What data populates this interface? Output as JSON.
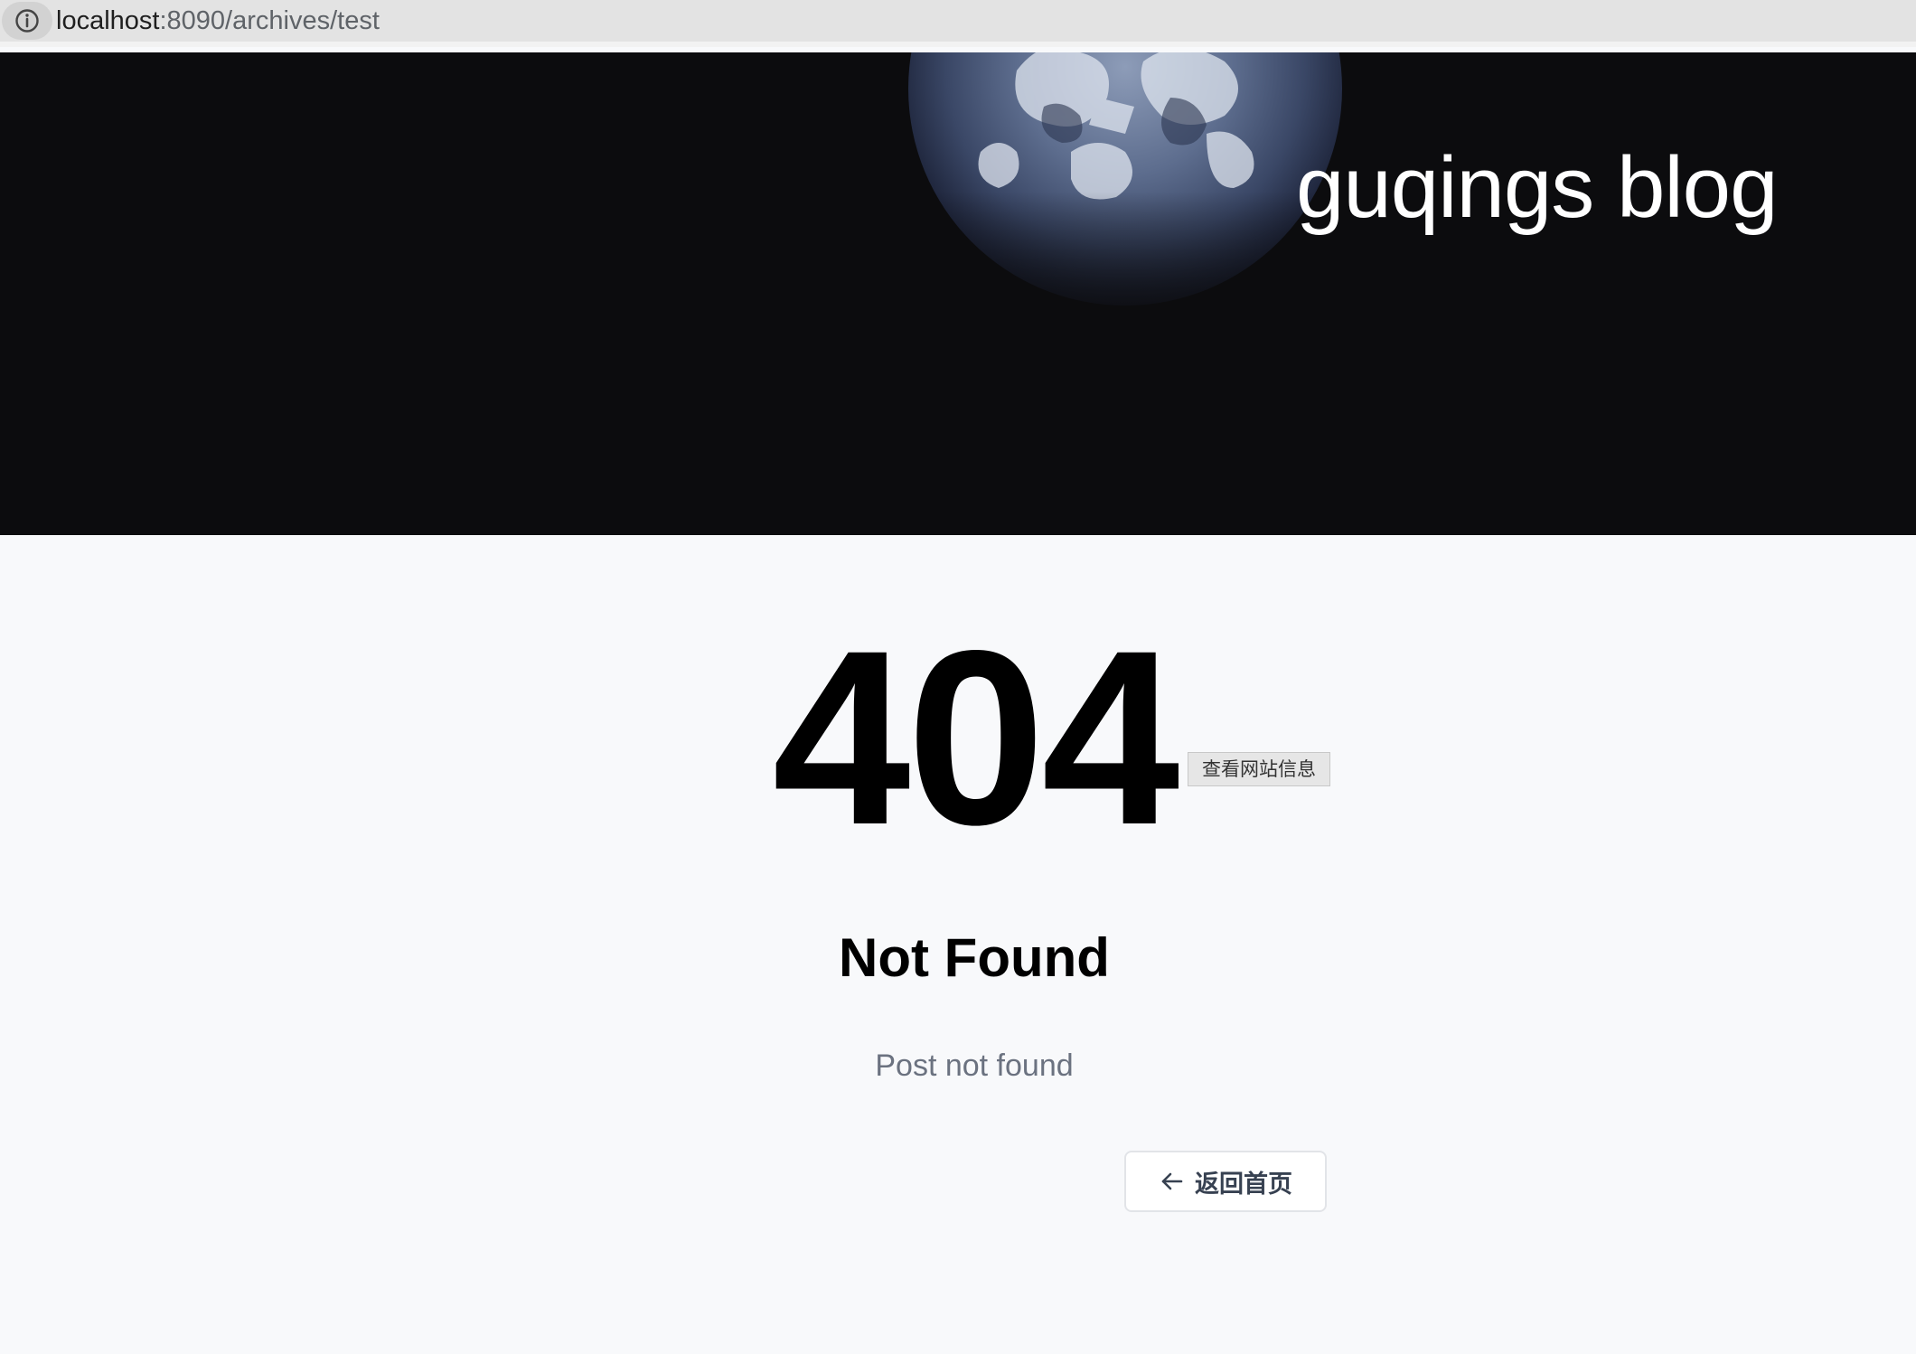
{
  "browser": {
    "url_host": "localhost",
    "url_path": ":8090/archives/test",
    "site_info_icon": "info-icon"
  },
  "header": {
    "blog_title": "guqings blog",
    "background_image": "earth-image"
  },
  "error": {
    "code": "404",
    "title": "Not Found",
    "message": "Post not found",
    "home_button_label": "返回首页",
    "home_button_icon": "arrow-left-icon"
  },
  "tooltip": {
    "text": "查看网站信息"
  },
  "colors": {
    "hero_background": "#0c0c0e",
    "page_background": "#f8f9fb",
    "message_text": "#6b7280"
  }
}
